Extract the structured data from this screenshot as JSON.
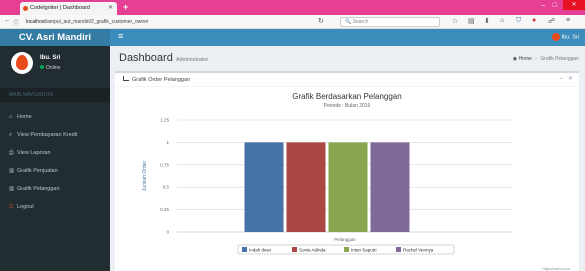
{
  "browser": {
    "tab_title": "CodeIgniter | Dashboard",
    "url_prefix": "localhost",
    "url_path": "/ampui_aut_mandiri/2_grafik_customer_owner",
    "search_placeholder": "Search"
  },
  "header": {
    "brand": "CV. Asri Mandiri",
    "user_name": "Ibu. Sri"
  },
  "sidebar": {
    "user_name": "Ibu. Sri",
    "user_status": "Online",
    "menu_header": "MAIN NAVIGATION",
    "items": [
      {
        "label": "Home",
        "icon": "home-icon"
      },
      {
        "label": "View Pembayaran Kredit",
        "icon": "search-icon"
      },
      {
        "label": "View Laporan",
        "icon": "print-icon"
      },
      {
        "label": "Grafik Penjualan",
        "icon": "bar-chart-icon"
      },
      {
        "label": "Grafik Pelanggan",
        "icon": "bar-chart-icon"
      },
      {
        "label": "Logout",
        "icon": "power-icon"
      }
    ]
  },
  "page": {
    "title": "Dashboard",
    "subtitle": "Administrator",
    "breadcrumb": [
      "Home",
      "Grafik Pelanggan"
    ]
  },
  "box": {
    "title": "Grafik Order Pelanggan"
  },
  "chart_data": {
    "type": "bar",
    "title": "Grafik Berdasarkan Pelanggan",
    "subtitle": "Periode : Bulan 2019",
    "xlabel": "Pelanggan",
    "ylabel": "Jumlah Order",
    "ylim": [
      0,
      1.25
    ],
    "yticks": [
      "0",
      "0.25",
      "0.5",
      "0.75",
      "1",
      "1.25"
    ],
    "grid": true,
    "legend_position": "bottom",
    "credits": "Highcharts.com",
    "series": [
      {
        "name": "Indah dewi",
        "values": [
          1
        ],
        "color": "#4572a7"
      },
      {
        "name": "Sonia Adinda",
        "values": [
          1
        ],
        "color": "#aa4643"
      },
      {
        "name": "Intan Saputri",
        "values": [
          1
        ],
        "color": "#89a54e"
      },
      {
        "name": "Rachel Vennya",
        "values": [
          1
        ],
        "color": "#80699b"
      }
    ]
  }
}
